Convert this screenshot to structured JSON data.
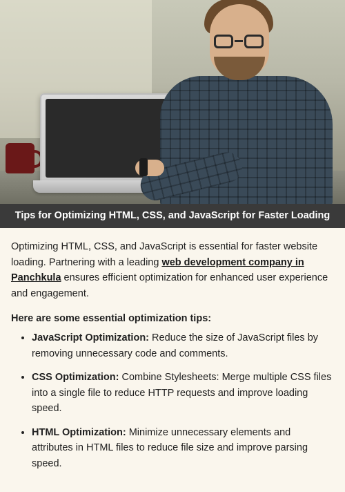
{
  "title_bar": "Tips for Optimizing HTML, CSS, and JavaScript for Faster Loading",
  "intro": {
    "pre_link": "Optimizing HTML, CSS, and JavaScript is essential for faster website loading. Partnering with a leading ",
    "link_text": "web development company in Panchkula",
    "post_link": " ensures efficient optimization for enhanced user experience and engagement."
  },
  "subheading": "Here are some essential optimization tips:",
  "tips": [
    {
      "label": "JavaScript Optimization:",
      "body": " Reduce the size of JavaScript files by removing unnecessary code and comments."
    },
    {
      "label": "CSS Optimization:",
      "body": " Combine Stylesheets: Merge multiple CSS files into a single file to reduce HTTP requests and improve loading speed."
    },
    {
      "label": "HTML Optimization:",
      "body": " Minimize unnecessary elements and attributes in HTML files to reduce file size and improve parsing speed."
    }
  ],
  "hero_alt": "A man wearing glasses and a plaid shirt sits at a desk typing on a silver laptop, with a red coffee mug beside him."
}
